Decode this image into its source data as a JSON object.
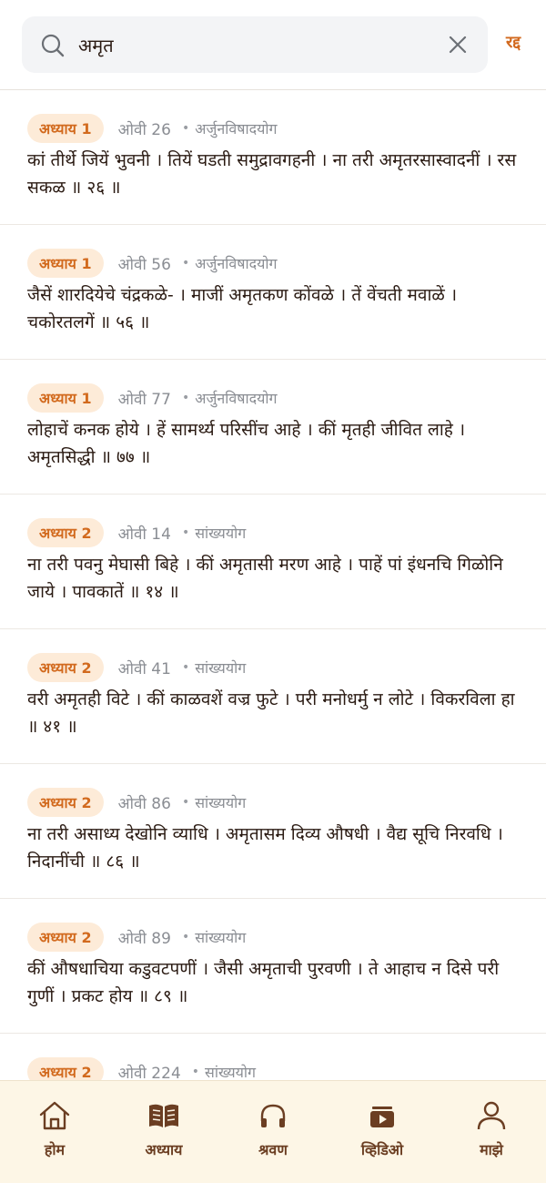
{
  "search": {
    "value": "अमृत",
    "cancel_label": "रद्द"
  },
  "results": [
    {
      "chapter": "अध्याय 1",
      "ovi": "ओवी 26",
      "chapter_name": "अर्जुनविषादयोग",
      "text": "कां तीर्थे जियें भुवनी । तियें घडती समुद्रावगहनी । ना तरी अमृतरसास्वादनीं । रस सकळ ॥ २६ ॥"
    },
    {
      "chapter": "अध्याय 1",
      "ovi": "ओवी 56",
      "chapter_name": "अर्जुनविषादयोग",
      "text": "जैसें शारदियेचे चंद्रकळे- । माजीं अमृतकण कोंवळे । तें वेंचती मवाळें । चकोरतलगें ॥ ५६ ॥"
    },
    {
      "chapter": "अध्याय 1",
      "ovi": "ओवी 77",
      "chapter_name": "अर्जुनविषादयोग",
      "text": "लोहाचें कनक होये । हें सामर्थ्य परिसींच आहे । कीं मृतही जीवित लाहे । अमृतसिद्धी ॥ ७७ ॥"
    },
    {
      "chapter": "अध्याय 2",
      "ovi": "ओवी 14",
      "chapter_name": "सांख्ययोग",
      "text": "ना तरी पवनु मेघासी बिहे । कीं अमृतासी मरण आहे । पाहें पां इंधनचि गिळोनि जाये । पावकातें ॥ १४ ॥"
    },
    {
      "chapter": "अध्याय 2",
      "ovi": "ओवी 41",
      "chapter_name": "सांख्ययोग",
      "text": "वरी अमृतही विटे । कीं काळवशें वज्र फुटे । परी मनोधर्मु न लोटे । विकरविला हा ॥ ४१ ॥"
    },
    {
      "chapter": "अध्याय 2",
      "ovi": "ओवी 86",
      "chapter_name": "सांख्ययोग",
      "text": "ना तरी असाध्य देखोनि व्याधि । अमृतासम दिव्य औषधी । वैद्य सूचि निरवधि । निदानींची ॥ ८६ ॥"
    },
    {
      "chapter": "अध्याय 2",
      "ovi": "ओवी 89",
      "chapter_name": "सांख्ययोग",
      "text": "कीं औषधाचिया कडुवटपणीं । जैसी अमृताची पुरवणी । ते आहाच न दिसे परी गुणीं । प्रकट होय ॥ ८९ ॥"
    },
    {
      "chapter": "अध्याय 2",
      "ovi": "ओवी 224",
      "chapter_name": "सांख्ययोग",
      "text": ""
    }
  ],
  "nav": {
    "home": "होम",
    "chapters": "अध्याय",
    "listen": "श्रवण",
    "videos": "व्हिडिओ",
    "profile": "माझे"
  },
  "colors": {
    "accent": "#d26a1e",
    "chip_bg": "#fdebd8",
    "nav_bg": "#fdf6e6",
    "nav_label": "#6b3e22"
  }
}
